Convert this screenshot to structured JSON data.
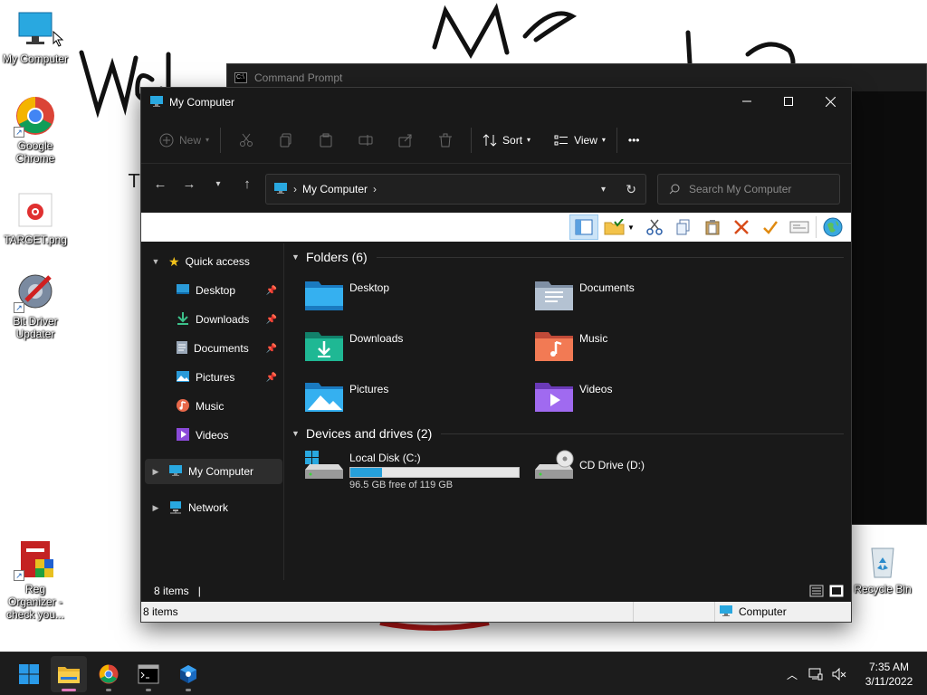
{
  "desktop": {
    "icons": [
      {
        "label": "My Computer"
      },
      {
        "label": "Google Chrome"
      },
      {
        "label": "TARGET.png"
      },
      {
        "label": "Bit Driver Updater"
      },
      {
        "label": "Reg Organizer - check you..."
      },
      {
        "label": "Recycle Bin"
      }
    ],
    "wallpaper_text": "T"
  },
  "cmd_window": {
    "title": "Command Prompt"
  },
  "explorer": {
    "title": "My Computer",
    "command_bar": {
      "new_label": "New",
      "sort_label": "Sort",
      "view_label": "View",
      "more_label": "•••"
    },
    "address": {
      "location": "My Computer"
    },
    "search": {
      "placeholder": "Search My Computer"
    },
    "nav": {
      "quick_access": "Quick access",
      "items": [
        {
          "label": "Desktop",
          "pinned": true
        },
        {
          "label": "Downloads",
          "pinned": true
        },
        {
          "label": "Documents",
          "pinned": true
        },
        {
          "label": "Pictures",
          "pinned": true
        },
        {
          "label": "Music",
          "pinned": false
        },
        {
          "label": "Videos",
          "pinned": false
        }
      ],
      "this_pc": "My Computer",
      "network": "Network"
    },
    "content": {
      "folders_header": "Folders (6)",
      "folders": [
        {
          "name": "Desktop"
        },
        {
          "name": "Documents"
        },
        {
          "name": "Downloads"
        },
        {
          "name": "Music"
        },
        {
          "name": "Pictures"
        },
        {
          "name": "Videos"
        }
      ],
      "drives_header": "Devices and drives (2)",
      "drives": [
        {
          "name": "Local Disk (C:)",
          "free_text": "96.5 GB free of 119 GB",
          "used_fraction": 0.19
        },
        {
          "name": "CD Drive (D:)"
        }
      ]
    },
    "status": {
      "items_count": "8 items",
      "cursor": "|"
    },
    "legacy_status": {
      "items_count": "8 items",
      "zone": "Computer"
    }
  },
  "taskbar": {
    "clock_time": "7:35 AM",
    "clock_date": "3/11/2022"
  },
  "colors": {
    "accent": "#26a0da",
    "explorer_bg": "#191919",
    "taskbar_bg": "#1c1c1c"
  }
}
